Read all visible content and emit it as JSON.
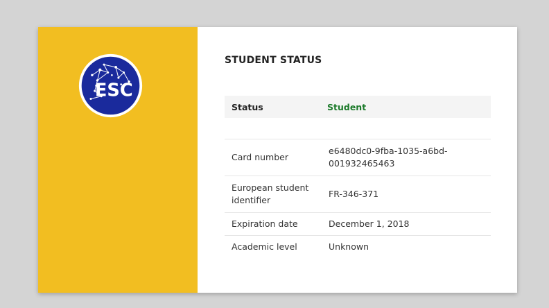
{
  "logo": {
    "text": "ESC",
    "icon": "esc-constellation-logo",
    "circle_color": "#1a2a9c"
  },
  "colors": {
    "left_panel": "#f2be21",
    "status_value": "#1c7a2a"
  },
  "title": "STUDENT STATUS",
  "status": {
    "label": "Status",
    "value": "Student"
  },
  "rows": [
    {
      "label": "Card number",
      "value": "e6480dc0-9fba-1035-a6bd-001932465463"
    },
    {
      "label": "European student identifier",
      "value": "FR-346-371"
    },
    {
      "label": "Expiration date",
      "value": "December 1, 2018"
    },
    {
      "label": "Academic level",
      "value": "Unknown"
    }
  ]
}
